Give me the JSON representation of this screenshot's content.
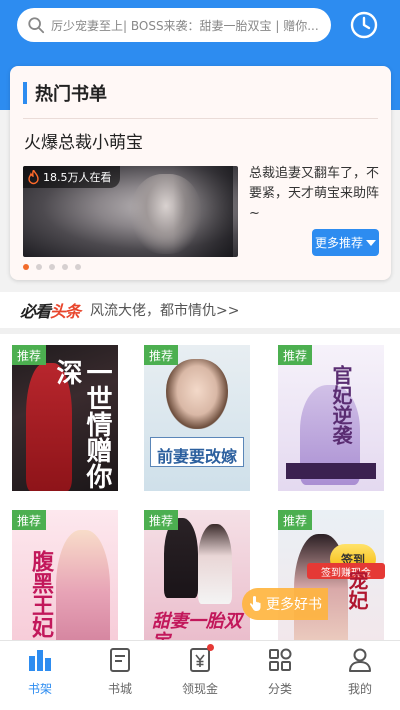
{
  "search": {
    "placeholder": "厉少宠妻至上| BOSS来袭：甜妻一胎双宝 | 赠你..."
  },
  "hot_list": {
    "title": "热门书单",
    "subtitle": "火爆总裁小萌宝",
    "readers": "18.5万人在看",
    "description": "总裁追妻又翻车了，不要紧，天才萌宝来助阵~",
    "more_button": "更多推荐",
    "carousel_pages": 5,
    "carousel_active_index": 0
  },
  "headline": {
    "logo_prefix": "必看",
    "logo_accent": "头条",
    "text": "风流大佬，都市情仇>>"
  },
  "books": [
    {
      "tag": "推荐",
      "cover_title": "一世情赠你深"
    },
    {
      "tag": "推荐",
      "cover_title": "前妻要改嫁"
    },
    {
      "tag": "推荐",
      "cover_title": "官妃逆袭"
    },
    {
      "tag": "推荐",
      "cover_title": "腹黑王妃"
    },
    {
      "tag": "推荐",
      "cover_title": "甜妻一胎双宝"
    },
    {
      "tag": "推荐",
      "cover_title": "宠妃"
    }
  ],
  "floating": {
    "signin": "签到",
    "signin_sub": "签到赚现金",
    "more_books": "更多好书"
  },
  "tabs": [
    {
      "label": "书架",
      "icon": "bookshelf-icon",
      "active": true
    },
    {
      "label": "书城",
      "icon": "book-city-icon",
      "active": false
    },
    {
      "label": "领现金",
      "icon": "cash-icon",
      "active": false,
      "badge": true
    },
    {
      "label": "分类",
      "icon": "category-icon",
      "active": false
    },
    {
      "label": "我的",
      "icon": "profile-icon",
      "active": false
    }
  ],
  "colors": {
    "primary": "#2d8cf0",
    "tag_green": "#4caf50",
    "accent_red": "#e53935",
    "dot_active": "#f26c2b"
  }
}
